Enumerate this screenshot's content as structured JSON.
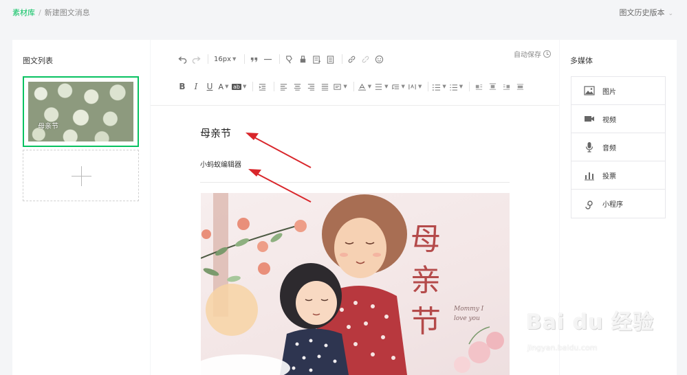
{
  "breadcrumb": {
    "home": "素材库",
    "separator": "/",
    "current": "新建图文消息"
  },
  "header": {
    "history_label": "图文历史版本"
  },
  "left_panel": {
    "title": "图文列表",
    "articles": [
      {
        "title": "母亲节",
        "cover": "white-roses-photo"
      }
    ],
    "add_icon": "plus-icon"
  },
  "toolbar": {
    "font_size": "16px",
    "autosave_label": "自动保存",
    "row1_icons": [
      "undo-icon",
      "redo-icon",
      "font-size-select",
      "blockquote-icon",
      "horizontal-rule-icon",
      "format-brush-icon",
      "clear-format-icon",
      "insert-template-icon",
      "insert-text-icon",
      "link-icon",
      "unlink-icon",
      "emoji-icon"
    ],
    "row2_icons": [
      "bold-icon",
      "italic-icon",
      "underline-icon",
      "font-color-icon",
      "highlight-icon",
      "indent-icon",
      "align-left-icon",
      "align-center-icon",
      "align-right-icon",
      "justify-icon",
      "align-more-icon",
      "letter-spacing-icon",
      "line-height-icon",
      "paragraph-spacing-icon",
      "text-direction-icon",
      "ordered-list-icon",
      "unordered-list-icon",
      "float-left-icon",
      "float-center-icon",
      "float-right-icon",
      "float-none-icon"
    ]
  },
  "editor": {
    "title": "母亲节",
    "author": "小蚂蚁编辑器",
    "poster": {
      "headline_chars": [
        "母",
        "亲",
        "节"
      ],
      "script_text": "Mommy I love you"
    }
  },
  "right_panel": {
    "title": "多媒体",
    "items": [
      {
        "label": "图片",
        "icon": "image-icon"
      },
      {
        "label": "视频",
        "icon": "video-icon"
      },
      {
        "label": "音频",
        "icon": "microphone-icon"
      },
      {
        "label": "投票",
        "icon": "bar-chart-icon"
      },
      {
        "label": "小程序",
        "icon": "mini-program-icon"
      }
    ]
  },
  "watermark": {
    "brand": "Bai du 经验",
    "url": "jingyan.baidu.com"
  },
  "colors": {
    "accent": "#07c160",
    "annotation_arrow": "#d9262b",
    "poster_red": "#b44a4a"
  }
}
